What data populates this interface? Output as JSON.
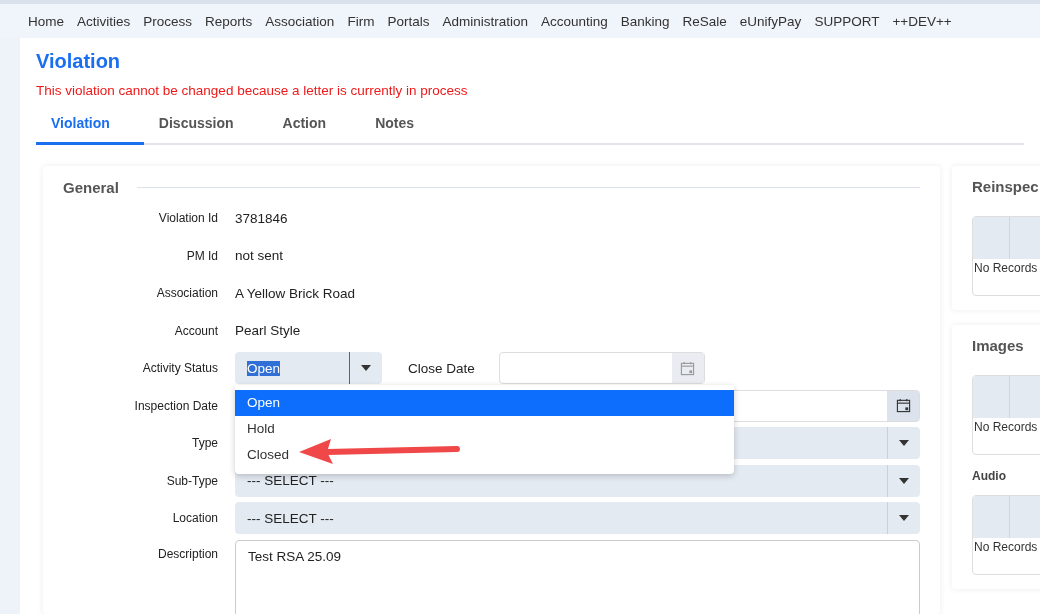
{
  "nav": [
    "Home",
    "Activities",
    "Process",
    "Reports",
    "Association",
    "Firm",
    "Portals",
    "Administration",
    "Accounting",
    "Banking",
    "ReSale",
    "eUnifyPay",
    "SUPPORT",
    "++DEV++"
  ],
  "page": {
    "title": "Violation",
    "error": "This violation cannot be changed because a letter is currently in process"
  },
  "tabs": [
    {
      "label": "Violation",
      "selected": true
    },
    {
      "label": "Discussion",
      "selected": false
    },
    {
      "label": "Action",
      "selected": false
    },
    {
      "label": "Notes",
      "selected": false
    }
  ],
  "general": {
    "title": "General",
    "fields": [
      {
        "kind": "text",
        "label": "Violation Id",
        "value": "3781846"
      },
      {
        "kind": "text",
        "label": "PM Id",
        "value": "not sent"
      },
      {
        "kind": "text",
        "label": "Association",
        "value": "A Yellow Brick Road"
      },
      {
        "kind": "text",
        "label": "Account",
        "value": "Pearl Style"
      },
      {
        "kind": "status",
        "label": "Activity Status",
        "value": "Open",
        "value_highlighted": true,
        "expanded": true,
        "extra_label": "Close Date",
        "options": [
          {
            "label": "Open",
            "selected": true
          },
          {
            "label": "Hold",
            "selected": false
          },
          {
            "label": "Closed",
            "selected": false
          }
        ]
      },
      {
        "kind": "date",
        "label": "Inspection Date"
      },
      {
        "kind": "select",
        "label": "Type"
      },
      {
        "kind": "select",
        "label": "Sub-Type",
        "value": "--- SELECT ---"
      },
      {
        "kind": "select",
        "label": "Location",
        "value": "--- SELECT ---"
      },
      {
        "kind": "textarea",
        "label": "Description",
        "value": "Test RSA 25.09"
      }
    ]
  },
  "side": [
    {
      "title": "Reinspec",
      "sections": [
        {
          "empty_text": "No Records"
        }
      ]
    },
    {
      "title": "Images",
      "sections": [
        {
          "empty_text": "No Records"
        },
        {
          "heading": "Audio",
          "empty_text": "No Records"
        }
      ]
    }
  ]
}
